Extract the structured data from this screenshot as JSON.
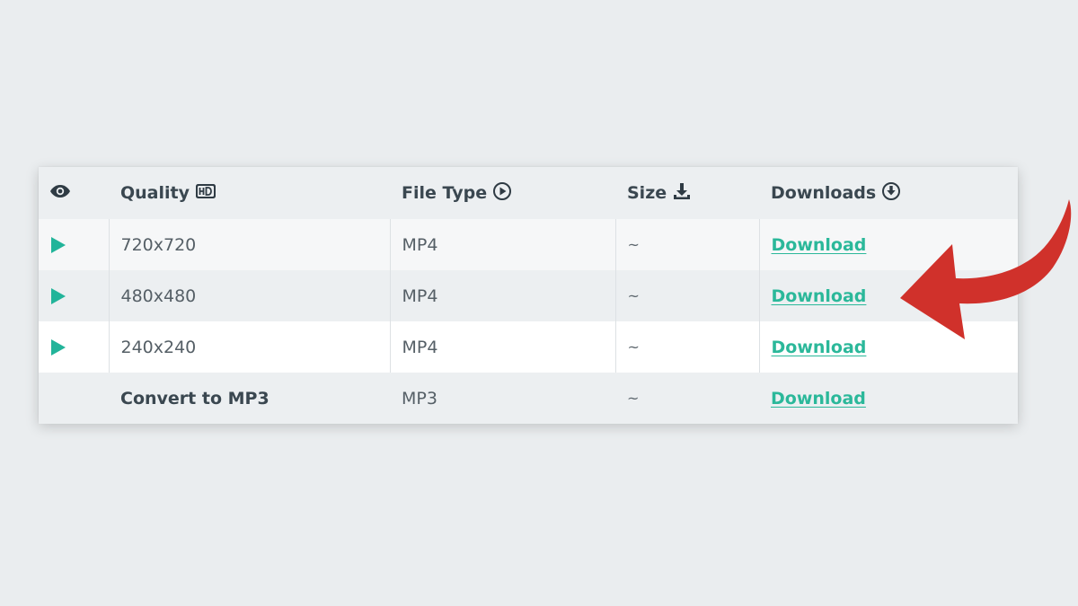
{
  "colors": {
    "accent": "#2bb89a",
    "play": "#22b49a",
    "arrow": "#d0312b",
    "header_text": "#3a4750"
  },
  "table": {
    "headers": {
      "preview_icon": "eye-icon",
      "quality": "Quality",
      "quality_icon": "hd-icon",
      "file_type": "File Type",
      "file_type_icon": "play-circle-icon",
      "size": "Size",
      "size_icon": "download-tray-icon",
      "downloads": "Downloads",
      "downloads_icon": "download-circle-icon"
    },
    "rows": [
      {
        "quality": "720x720",
        "type": "MP4",
        "size": "~",
        "link": "Download",
        "preview": true
      },
      {
        "quality": "480x480",
        "type": "MP4",
        "size": "~",
        "link": "Download",
        "preview": true
      },
      {
        "quality": "240x240",
        "type": "MP4",
        "size": "~",
        "link": "Download",
        "preview": true
      },
      {
        "quality": "Convert to MP3",
        "type": "MP3",
        "size": "~",
        "link": "Download",
        "preview": false
      }
    ]
  },
  "annotation": {
    "icon": "red-curved-arrow-icon"
  }
}
